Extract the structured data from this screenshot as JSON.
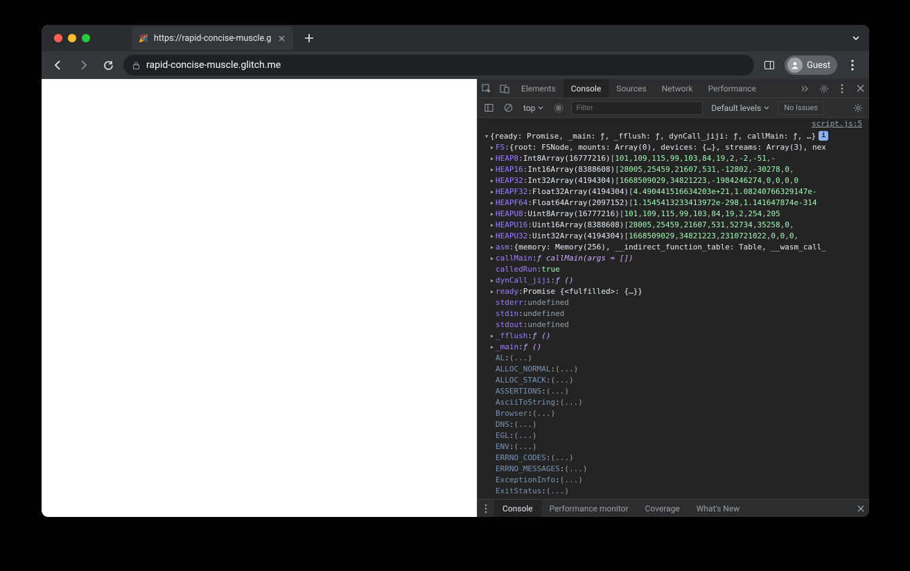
{
  "browser": {
    "tab_title": "https://rapid-concise-muscle.g",
    "url_display": "rapid-concise-muscle.glitch.me",
    "guest_label": "Guest"
  },
  "devtools": {
    "tabs": [
      "Elements",
      "Console",
      "Sources",
      "Network",
      "Performance"
    ],
    "active_tab": "Console",
    "context_selector": "top",
    "filter_placeholder": "Filter",
    "levels_label": "Default levels",
    "issues_label": "No Issues",
    "source_link": "script.js:5",
    "summary_line": "{ready: Promise, _main: ƒ, _fflush: ƒ, dynCall_jiji: ƒ, callMain: ƒ, …}",
    "entries": [
      {
        "arrow": "right",
        "key": "FS",
        "preview": "{root: FSNode, mounts: Array(0), devices: {…}, streams: Array(3), nex"
      },
      {
        "arrow": "right",
        "key": "HEAP8",
        "type": "Int8Array(16777216)",
        "nums": [
          "101",
          "109",
          "115",
          "99",
          "103",
          "84",
          "19",
          "2",
          "-2",
          "-51",
          "-"
        ]
      },
      {
        "arrow": "right",
        "key": "HEAP16",
        "type": "Int16Array(8388608)",
        "nums": [
          "28005",
          "25459",
          "21607",
          "531",
          "-12802",
          "-30278",
          "0",
          ""
        ]
      },
      {
        "arrow": "right",
        "key": "HEAP32",
        "type": "Int32Array(4194304)",
        "nums": [
          "1668509029",
          "34821223",
          "-1984246274",
          "0",
          "0",
          "0",
          "0"
        ]
      },
      {
        "arrow": "right",
        "key": "HEAPF32",
        "type": "Float32Array(4194304)",
        "nums": [
          "4.490441516634203e+21",
          "1.08240766329147e-"
        ]
      },
      {
        "arrow": "right",
        "key": "HEAPF64",
        "type": "Float64Array(2097152)",
        "nums": [
          "1.1545413233413972e-298",
          "1.141647874e-314"
        ]
      },
      {
        "arrow": "right",
        "key": "HEAPU8",
        "type": "Uint8Array(16777216)",
        "nums": [
          "101",
          "109",
          "115",
          "99",
          "103",
          "84",
          "19",
          "2",
          "254",
          "205"
        ]
      },
      {
        "arrow": "right",
        "key": "HEAPU16",
        "type": "Uint16Array(8388608)",
        "nums": [
          "28005",
          "25459",
          "21607",
          "531",
          "52734",
          "35258",
          "0",
          ""
        ]
      },
      {
        "arrow": "right",
        "key": "HEAPU32",
        "type": "Uint32Array(4194304)",
        "nums": [
          "1668509029",
          "34821223",
          "2310721022",
          "0",
          "0",
          "0",
          ""
        ]
      },
      {
        "arrow": "right",
        "key": "asm",
        "preview": "{memory: Memory(256), __indirect_function_table: Table, __wasm_call_"
      },
      {
        "arrow": "right",
        "key": "callMain",
        "fn": "ƒ callMain(args = [])"
      },
      {
        "arrow": "none",
        "key": "calledRun",
        "bool": "true"
      },
      {
        "arrow": "right",
        "key": "dynCall_jiji",
        "fn": "ƒ ()"
      },
      {
        "arrow": "right",
        "key": "ready",
        "preview": "Promise {<fulfilled>: {…}}"
      },
      {
        "arrow": "none",
        "key": "stderr",
        "undef": "undefined"
      },
      {
        "arrow": "none",
        "key": "stdin",
        "undef": "undefined"
      },
      {
        "arrow": "none",
        "key": "stdout",
        "undef": "undefined"
      },
      {
        "arrow": "right",
        "key": "_fflush",
        "fn": "ƒ ()"
      },
      {
        "arrow": "right",
        "key": "_main",
        "fn": "ƒ ()"
      },
      {
        "arrow": "none",
        "dim": true,
        "key": "AL",
        "ellipsis": "(...)"
      },
      {
        "arrow": "none",
        "dim": true,
        "key": "ALLOC_NORMAL",
        "ellipsis": "(...)"
      },
      {
        "arrow": "none",
        "dim": true,
        "key": "ALLOC_STACK",
        "ellipsis": "(...)"
      },
      {
        "arrow": "none",
        "dim": true,
        "key": "ASSERTIONS",
        "ellipsis": "(...)"
      },
      {
        "arrow": "none",
        "dim": true,
        "key": "AsciiToString",
        "ellipsis": "(...)"
      },
      {
        "arrow": "none",
        "dim": true,
        "key": "Browser",
        "ellipsis": "(...)"
      },
      {
        "arrow": "none",
        "dim": true,
        "key": "DNS",
        "ellipsis": "(...)"
      },
      {
        "arrow": "none",
        "dim": true,
        "key": "EGL",
        "ellipsis": "(...)"
      },
      {
        "arrow": "none",
        "dim": true,
        "key": "ENV",
        "ellipsis": "(...)"
      },
      {
        "arrow": "none",
        "dim": true,
        "key": "ERRNO_CODES",
        "ellipsis": "(...)"
      },
      {
        "arrow": "none",
        "dim": true,
        "key": "ERRNO_MESSAGES",
        "ellipsis": "(...)"
      },
      {
        "arrow": "none",
        "dim": true,
        "key": "ExceptionInfo",
        "ellipsis": "(...)"
      },
      {
        "arrow": "none",
        "dim": true,
        "key": "ExitStatus",
        "ellipsis": "(...)"
      }
    ],
    "drawer_tabs": [
      "Console",
      "Performance monitor",
      "Coverage",
      "What's New"
    ],
    "drawer_active": "Console"
  }
}
